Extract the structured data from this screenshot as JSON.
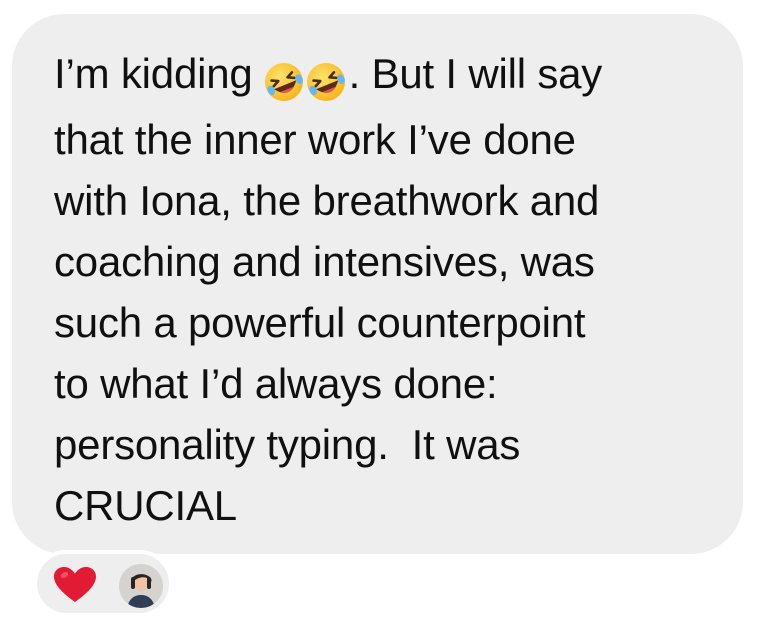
{
  "message": {
    "lines": [
      "I’m kidding",
      "that the inner work I’ve done",
      "with Iona, the breathwork and",
      "coaching and intensives, was",
      "such a powerful counterpoint",
      "to what I’d always done:",
      "personality typing.  It was",
      "CRUCIAL"
    ],
    "line1_after_emoji": ". But I will say",
    "emoji": [
      "rolling-on-floor-laughing-emoji",
      "rolling-on-floor-laughing-emoji"
    ]
  },
  "reactions": {
    "items": [
      {
        "icon": "red-heart-icon"
      }
    ],
    "reactor_avatar": "avatar"
  },
  "colors": {
    "bubble_background": "#eeeeee",
    "text": "#101010",
    "heart": "#e21b35",
    "page_background": "#ffffff"
  }
}
